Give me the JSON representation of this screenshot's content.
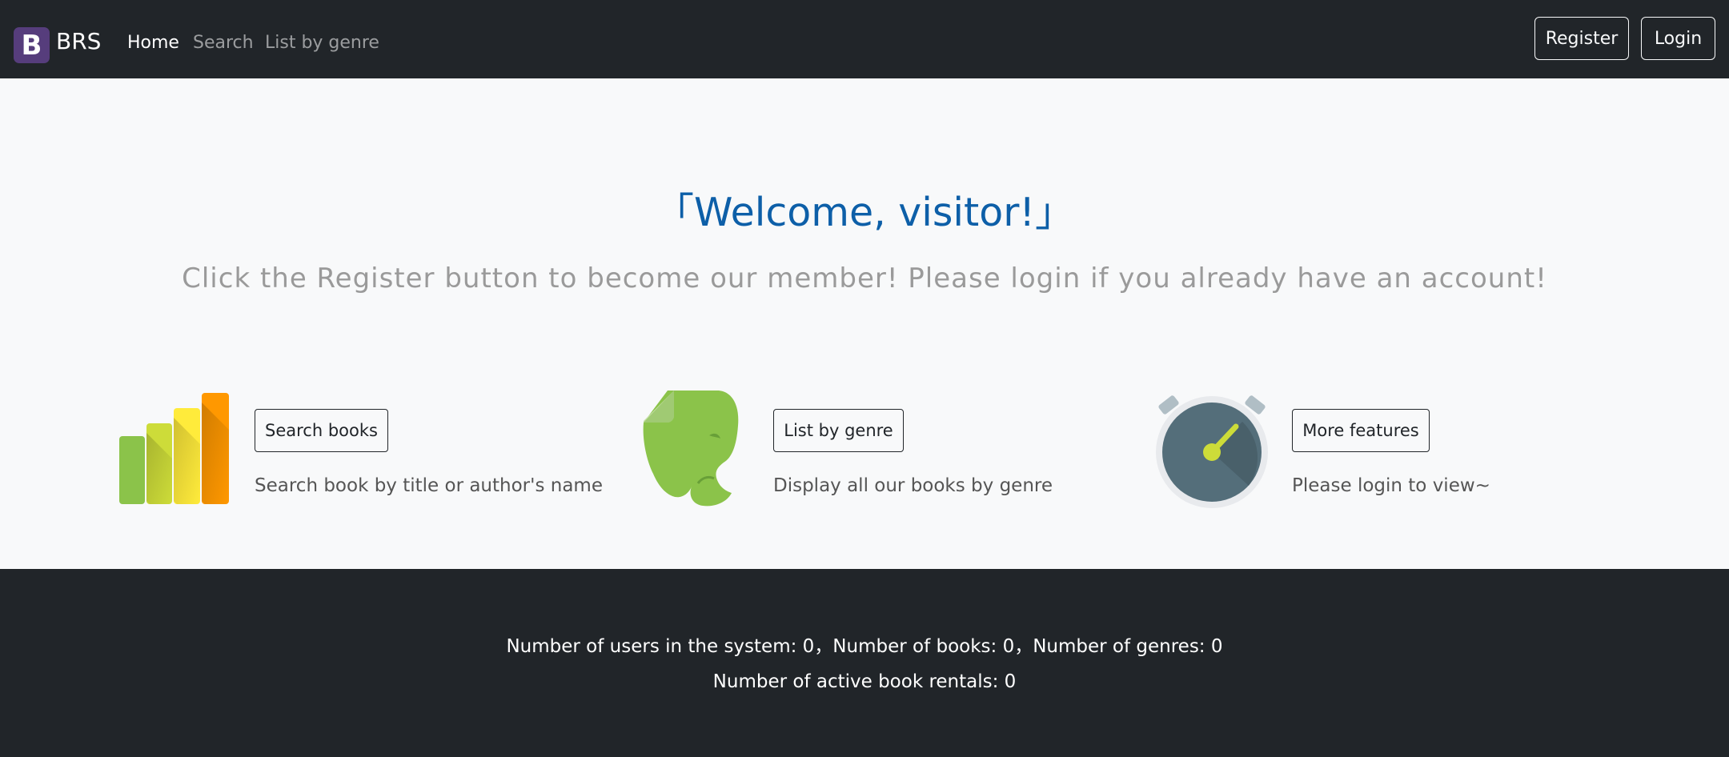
{
  "navbar": {
    "logo_letter": "B",
    "brand": "BRS",
    "links": [
      {
        "label": "Home",
        "active": true
      },
      {
        "label": "Search",
        "active": false
      },
      {
        "label": "List by genre",
        "active": false
      }
    ],
    "register_label": "Register",
    "login_label": "Login"
  },
  "hero": {
    "title": "「Welcome, visitor!」",
    "subtitle": "Click the Register button to become our member! Please login if you already have an account!"
  },
  "features": [
    {
      "icon": "bar-chart-icon",
      "button": "Search books",
      "description": "Search book by title or author's name"
    },
    {
      "icon": "evernote-elephant-icon",
      "button": "List by genre",
      "description": "Display all our books by genre"
    },
    {
      "icon": "stopwatch-icon",
      "button": "More features",
      "description": "Please login to view~"
    }
  ],
  "footer": {
    "line1": "Number of users in the system: 0，Number of books: 0，Number of genres: 0",
    "line2": "Number of active book rentals: 0"
  },
  "colors": {
    "navbar_bg": "#212529",
    "brand_logo_bg": "#563d7c",
    "hero_title": "#0d5fa8",
    "page_bg": "#f8f9fa"
  }
}
